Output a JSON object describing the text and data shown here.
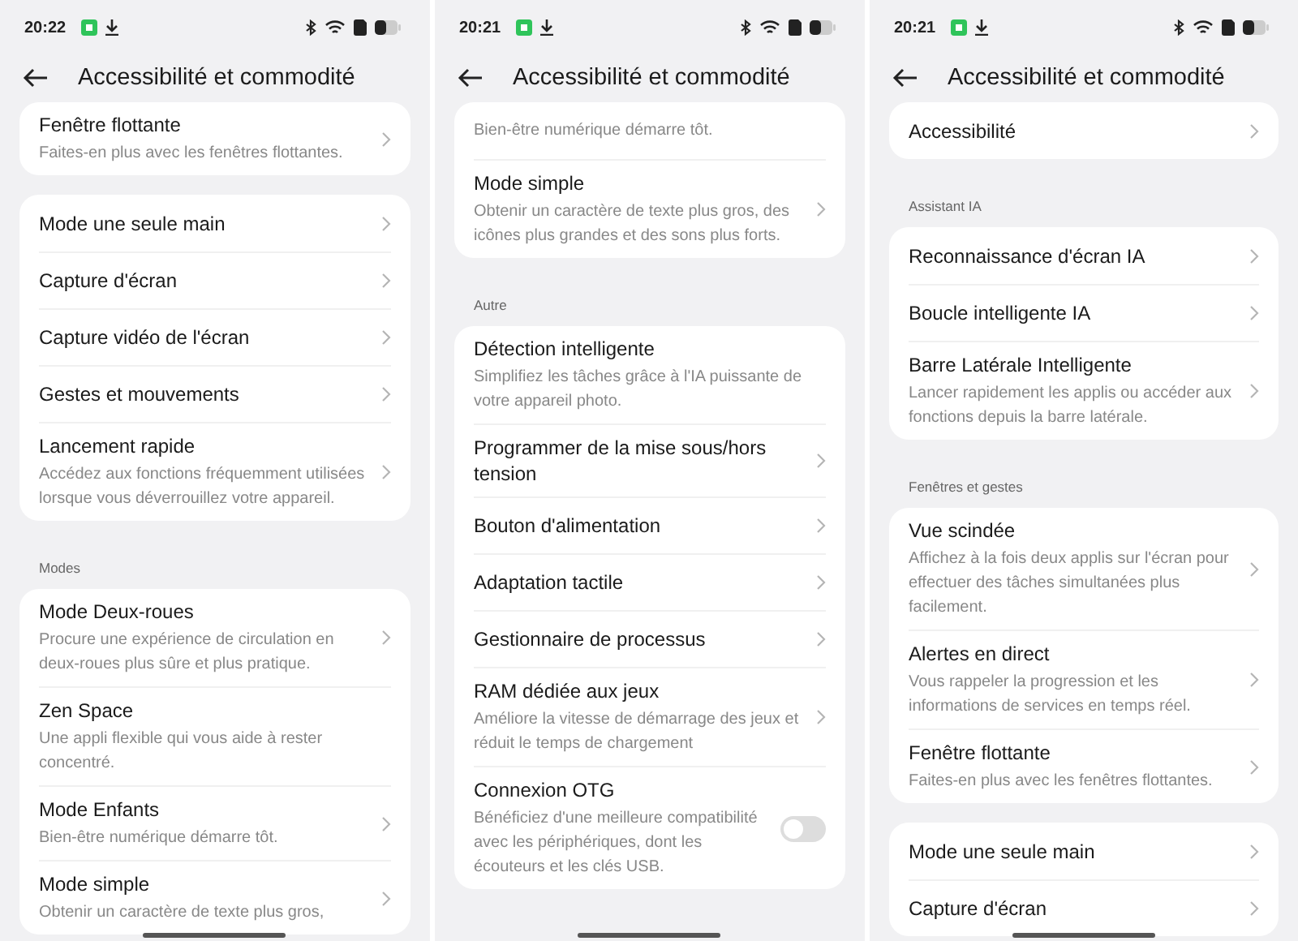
{
  "screens": [
    {
      "time": "20:22",
      "title": "Accessibilité et commodité",
      "blocks": [
        {
          "kind": "card",
          "items": [
            {
              "kind": "link",
              "title": "Fenêtre flottante",
              "subtitle": "Faites-en plus avec les fenêtres flottantes."
            }
          ]
        },
        {
          "kind": "card",
          "items": [
            {
              "kind": "link",
              "title": "Mode une seule main"
            },
            {
              "kind": "link",
              "title": "Capture d'écran"
            },
            {
              "kind": "link",
              "title": "Capture vidéo de l'écran"
            },
            {
              "kind": "link",
              "title": "Gestes et mouvements"
            },
            {
              "kind": "link",
              "title": "Lancement rapide",
              "subtitle": "Accédez aux fonctions fréquemment utilisées lorsque vous déverrouillez votre appareil."
            }
          ]
        },
        {
          "kind": "section",
          "header": "Modes"
        },
        {
          "kind": "card",
          "items": [
            {
              "kind": "link",
              "title": "Mode Deux-roues",
              "subtitle": "Procure une expérience de circulation en deux-roues plus sûre et plus pratique."
            },
            {
              "kind": "plain",
              "title": "Zen Space",
              "subtitle": "Une appli flexible qui vous aide à rester concentré."
            },
            {
              "kind": "link",
              "title": "Mode Enfants",
              "subtitle": "Bien-être numérique démarre tôt."
            },
            {
              "kind": "link",
              "title": "Mode simple",
              "subtitle": "Obtenir un caractère de texte plus gros,"
            }
          ]
        }
      ]
    },
    {
      "time": "20:21",
      "title": "Accessibilité et commodité",
      "blocks": [
        {
          "kind": "card",
          "items": [
            {
              "kind": "plain",
              "subtitle": "Bien-être numérique démarre tôt."
            },
            {
              "kind": "link",
              "title": "Mode simple",
              "subtitle": "Obtenir un caractère de texte plus gros, des icônes plus grandes et des sons plus forts."
            }
          ]
        },
        {
          "kind": "section",
          "header": "Autre"
        },
        {
          "kind": "card",
          "items": [
            {
              "kind": "plain",
              "title": "Détection intelligente",
              "subtitle": "Simplifiez les tâches grâce à l'IA puissante de votre appareil photo."
            },
            {
              "kind": "link",
              "title": "Programmer de la mise sous/hors tension"
            },
            {
              "kind": "link",
              "title": "Bouton d'alimentation"
            },
            {
              "kind": "link",
              "title": "Adaptation tactile"
            },
            {
              "kind": "link",
              "title": "Gestionnaire de processus"
            },
            {
              "kind": "link",
              "title": "RAM dédiée aux jeux",
              "subtitle": "Améliore la vitesse de démarrage des jeux et réduit le temps de chargement"
            },
            {
              "kind": "toggle",
              "on": false,
              "title": "Connexion OTG",
              "subtitle": "Bénéficiez d'une meilleure compatibilité avec les périphériques, dont les écouteurs et les clés USB."
            }
          ]
        }
      ]
    },
    {
      "time": "20:21",
      "title": "Accessibilité et commodité",
      "blocks": [
        {
          "kind": "card",
          "items": [
            {
              "kind": "link",
              "title": "Accessibilité"
            }
          ]
        },
        {
          "kind": "section",
          "header": "Assistant IA"
        },
        {
          "kind": "card",
          "items": [
            {
              "kind": "link",
              "title": "Reconnaissance d'écran IA"
            },
            {
              "kind": "link",
              "title": "Boucle intelligente IA"
            },
            {
              "kind": "link",
              "title": "Barre Latérale Intelligente",
              "subtitle": "Lancer rapidement les applis ou accéder aux fonctions depuis la barre latérale."
            }
          ]
        },
        {
          "kind": "section",
          "header": "Fenêtres et gestes"
        },
        {
          "kind": "card",
          "items": [
            {
              "kind": "link",
              "title": "Vue scindée",
              "subtitle": "Affichez à la fois deux applis sur l'écran pour effectuer des tâches simultanées plus facilement."
            },
            {
              "kind": "link",
              "title": "Alertes en direct",
              "subtitle": "Vous rappeler la progression et les informations de services en temps réel."
            },
            {
              "kind": "link",
              "title": "Fenêtre flottante",
              "subtitle": "Faites-en plus avec les fenêtres flottantes."
            }
          ]
        },
        {
          "kind": "card",
          "items": [
            {
              "kind": "link",
              "title": "Mode une seule main"
            },
            {
              "kind": "link",
              "title": "Capture d'écran"
            }
          ]
        }
      ]
    }
  ]
}
